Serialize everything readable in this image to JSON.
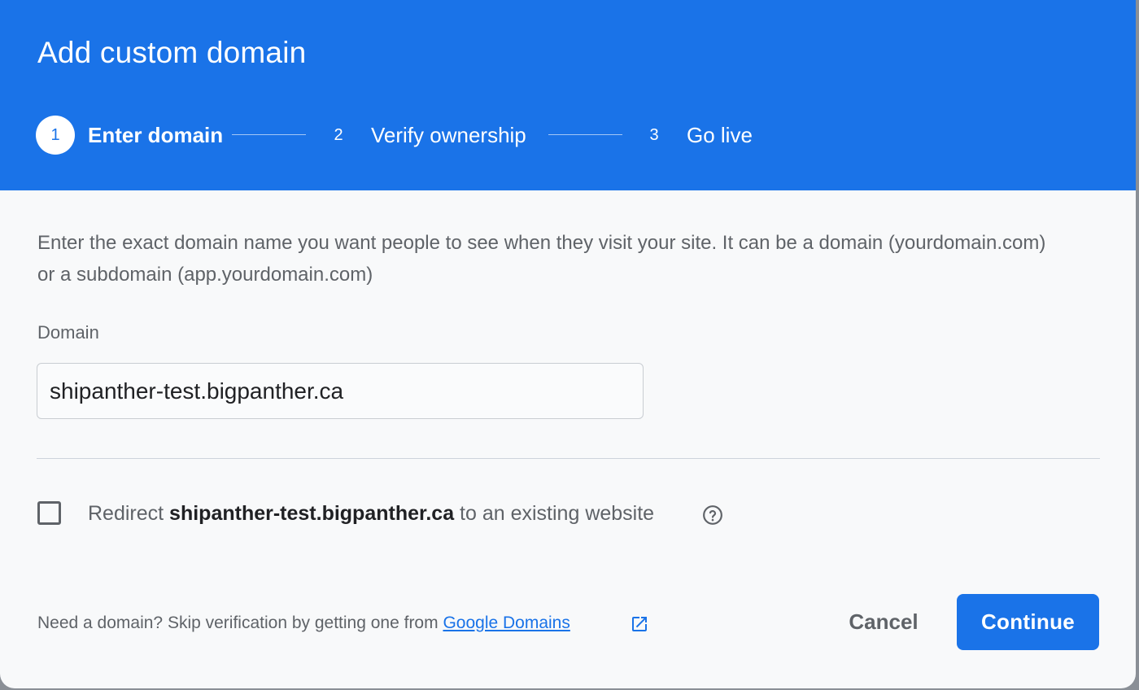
{
  "dialog": {
    "title": "Add custom domain",
    "steps": [
      {
        "number": "1",
        "label": "Enter domain",
        "active": true
      },
      {
        "number": "2",
        "label": "Verify ownership",
        "active": false
      },
      {
        "number": "3",
        "label": "Go live",
        "active": false
      }
    ],
    "description": "Enter the exact domain name you want people to see when they visit your site. It can be a domain (yourdomain.com) or a subdomain (app.yourdomain.com)",
    "domain_field": {
      "label": "Domain",
      "value": "shipanther-test.bigpanther.ca"
    },
    "redirect": {
      "checked": false,
      "prefix": "Redirect ",
      "domain": "shipanther-test.bigpanther.ca",
      "suffix": " to an existing website",
      "help_icon": "help-circle-icon"
    },
    "footer": {
      "note": "Need a domain? Skip verification by getting one from ",
      "link_label": "Google Domains",
      "link_icon": "open-in-new-icon"
    },
    "buttons": {
      "cancel": "Cancel",
      "continue": "Continue"
    },
    "colors": {
      "primary": "#1a73e8",
      "header_text": "#ffffff",
      "body_background": "#f8f9fa",
      "muted_text": "#5f6368"
    }
  }
}
